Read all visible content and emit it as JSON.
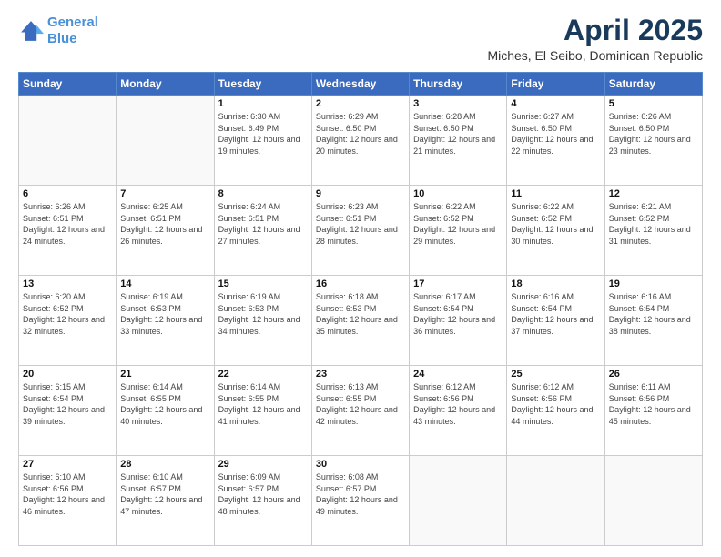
{
  "header": {
    "logo_line1": "General",
    "logo_line2": "Blue",
    "month_year": "April 2025",
    "location": "Miches, El Seibo, Dominican Republic"
  },
  "days_of_week": [
    "Sunday",
    "Monday",
    "Tuesday",
    "Wednesday",
    "Thursday",
    "Friday",
    "Saturday"
  ],
  "weeks": [
    [
      {
        "day": "",
        "info": ""
      },
      {
        "day": "",
        "info": ""
      },
      {
        "day": "1",
        "info": "Sunrise: 6:30 AM\nSunset: 6:49 PM\nDaylight: 12 hours and 19 minutes."
      },
      {
        "day": "2",
        "info": "Sunrise: 6:29 AM\nSunset: 6:50 PM\nDaylight: 12 hours and 20 minutes."
      },
      {
        "day": "3",
        "info": "Sunrise: 6:28 AM\nSunset: 6:50 PM\nDaylight: 12 hours and 21 minutes."
      },
      {
        "day": "4",
        "info": "Sunrise: 6:27 AM\nSunset: 6:50 PM\nDaylight: 12 hours and 22 minutes."
      },
      {
        "day": "5",
        "info": "Sunrise: 6:26 AM\nSunset: 6:50 PM\nDaylight: 12 hours and 23 minutes."
      }
    ],
    [
      {
        "day": "6",
        "info": "Sunrise: 6:26 AM\nSunset: 6:51 PM\nDaylight: 12 hours and 24 minutes."
      },
      {
        "day": "7",
        "info": "Sunrise: 6:25 AM\nSunset: 6:51 PM\nDaylight: 12 hours and 26 minutes."
      },
      {
        "day": "8",
        "info": "Sunrise: 6:24 AM\nSunset: 6:51 PM\nDaylight: 12 hours and 27 minutes."
      },
      {
        "day": "9",
        "info": "Sunrise: 6:23 AM\nSunset: 6:51 PM\nDaylight: 12 hours and 28 minutes."
      },
      {
        "day": "10",
        "info": "Sunrise: 6:22 AM\nSunset: 6:52 PM\nDaylight: 12 hours and 29 minutes."
      },
      {
        "day": "11",
        "info": "Sunrise: 6:22 AM\nSunset: 6:52 PM\nDaylight: 12 hours and 30 minutes."
      },
      {
        "day": "12",
        "info": "Sunrise: 6:21 AM\nSunset: 6:52 PM\nDaylight: 12 hours and 31 minutes."
      }
    ],
    [
      {
        "day": "13",
        "info": "Sunrise: 6:20 AM\nSunset: 6:52 PM\nDaylight: 12 hours and 32 minutes."
      },
      {
        "day": "14",
        "info": "Sunrise: 6:19 AM\nSunset: 6:53 PM\nDaylight: 12 hours and 33 minutes."
      },
      {
        "day": "15",
        "info": "Sunrise: 6:19 AM\nSunset: 6:53 PM\nDaylight: 12 hours and 34 minutes."
      },
      {
        "day": "16",
        "info": "Sunrise: 6:18 AM\nSunset: 6:53 PM\nDaylight: 12 hours and 35 minutes."
      },
      {
        "day": "17",
        "info": "Sunrise: 6:17 AM\nSunset: 6:54 PM\nDaylight: 12 hours and 36 minutes."
      },
      {
        "day": "18",
        "info": "Sunrise: 6:16 AM\nSunset: 6:54 PM\nDaylight: 12 hours and 37 minutes."
      },
      {
        "day": "19",
        "info": "Sunrise: 6:16 AM\nSunset: 6:54 PM\nDaylight: 12 hours and 38 minutes."
      }
    ],
    [
      {
        "day": "20",
        "info": "Sunrise: 6:15 AM\nSunset: 6:54 PM\nDaylight: 12 hours and 39 minutes."
      },
      {
        "day": "21",
        "info": "Sunrise: 6:14 AM\nSunset: 6:55 PM\nDaylight: 12 hours and 40 minutes."
      },
      {
        "day": "22",
        "info": "Sunrise: 6:14 AM\nSunset: 6:55 PM\nDaylight: 12 hours and 41 minutes."
      },
      {
        "day": "23",
        "info": "Sunrise: 6:13 AM\nSunset: 6:55 PM\nDaylight: 12 hours and 42 minutes."
      },
      {
        "day": "24",
        "info": "Sunrise: 6:12 AM\nSunset: 6:56 PM\nDaylight: 12 hours and 43 minutes."
      },
      {
        "day": "25",
        "info": "Sunrise: 6:12 AM\nSunset: 6:56 PM\nDaylight: 12 hours and 44 minutes."
      },
      {
        "day": "26",
        "info": "Sunrise: 6:11 AM\nSunset: 6:56 PM\nDaylight: 12 hours and 45 minutes."
      }
    ],
    [
      {
        "day": "27",
        "info": "Sunrise: 6:10 AM\nSunset: 6:56 PM\nDaylight: 12 hours and 46 minutes."
      },
      {
        "day": "28",
        "info": "Sunrise: 6:10 AM\nSunset: 6:57 PM\nDaylight: 12 hours and 47 minutes."
      },
      {
        "day": "29",
        "info": "Sunrise: 6:09 AM\nSunset: 6:57 PM\nDaylight: 12 hours and 48 minutes."
      },
      {
        "day": "30",
        "info": "Sunrise: 6:08 AM\nSunset: 6:57 PM\nDaylight: 12 hours and 49 minutes."
      },
      {
        "day": "",
        "info": ""
      },
      {
        "day": "",
        "info": ""
      },
      {
        "day": "",
        "info": ""
      }
    ]
  ]
}
